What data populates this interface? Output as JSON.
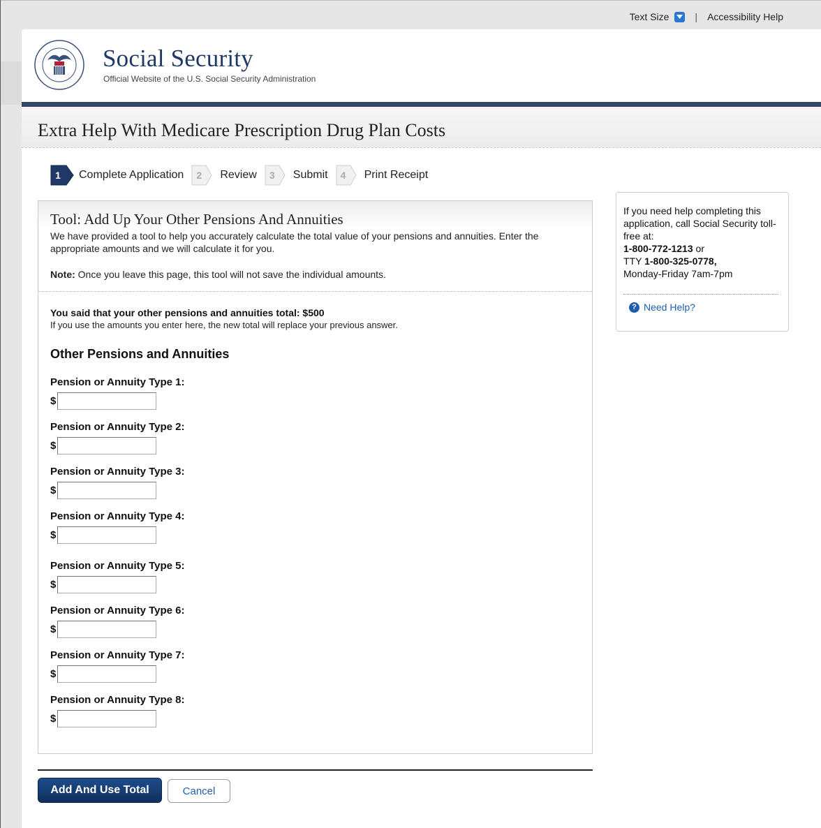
{
  "utility": {
    "text_size": "Text Size",
    "separator": "|",
    "accessibility": "Accessibility Help"
  },
  "header": {
    "title": "Social Security",
    "subtitle": "Official Website of the U.S. Social Security Administration",
    "seal_text": "SOCIAL SECURITY ADMINISTRATION USA"
  },
  "page_title": "Extra Help With Medicare Prescription Drug Plan Costs",
  "steps": [
    {
      "num": "1",
      "label": "Complete Application",
      "state": "active"
    },
    {
      "num": "2",
      "label": "Review",
      "state": "inactive"
    },
    {
      "num": "3",
      "label": "Submit",
      "state": "inactive"
    },
    {
      "num": "4",
      "label": "Print Receipt",
      "state": "inactive"
    }
  ],
  "tool": {
    "title": "Tool: Add Up Your Other Pensions And Annuities",
    "description": "We have provided a tool to help you accurately calculate the total value of your pensions and annuities. Enter the appropriate amounts and we will calculate it for you.",
    "note_label": "Note:",
    "note_text": " Once you leave this page, this tool will not save the individual amounts.",
    "said": "You said that your other pensions and annuities total: $500",
    "said_sub": "If you use the amounts you enter here, the new total will replace your previous answer.",
    "section_title": "Other Pensions and Annuities",
    "currency": "$",
    "fields": [
      {
        "label": "Pension or Annuity Type 1:",
        "value": ""
      },
      {
        "label": "Pension or Annuity Type 2:",
        "value": ""
      },
      {
        "label": "Pension or Annuity Type 3:",
        "value": ""
      },
      {
        "label": "Pension or Annuity Type 4:",
        "value": ""
      },
      {
        "label": "Pension or Annuity Type 5:",
        "value": ""
      },
      {
        "label": "Pension or Annuity Type 6:",
        "value": ""
      },
      {
        "label": "Pension or Annuity Type 7:",
        "value": ""
      },
      {
        "label": "Pension or Annuity Type 8:",
        "value": ""
      }
    ]
  },
  "buttons": {
    "primary": "Add And Use Total",
    "secondary": "Cancel"
  },
  "help": {
    "line1": "If you need help completing this application, call Social Security toll-free at:",
    "phone": "1-800-772-1213",
    "or": " or",
    "tty_prefix": "TTY ",
    "tty": "1-800-325-0778,",
    "hours": "Monday-Friday 7am-7pm",
    "link": "Need Help?"
  },
  "colors": {
    "navy": "#34476b",
    "brand": "#1f3866",
    "link": "#1d5fae",
    "button": "#163f78"
  }
}
